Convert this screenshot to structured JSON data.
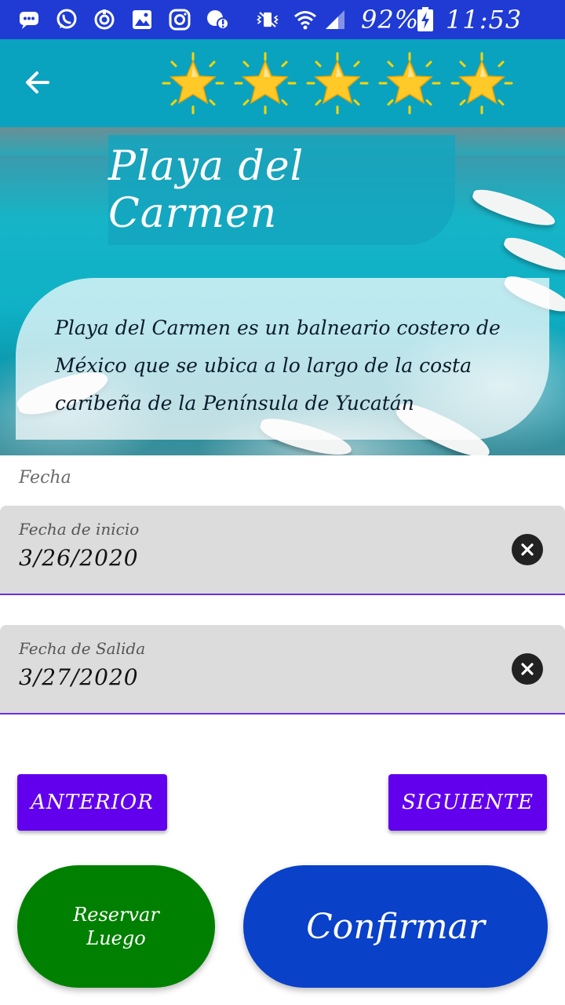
{
  "status_bar": {
    "battery": "92%",
    "time": "11:53 PM",
    "background": "#1f3bd4",
    "icons": [
      "messages-icon",
      "whatsapp-icon",
      "sync-icon",
      "gallery-icon",
      "instagram-icon",
      "chat-alert-icon",
      "vibrate-icon",
      "wifi-icon",
      "signal-icon",
      "battery-charging-icon"
    ]
  },
  "toolbar": {
    "back_icon": "arrow-left-icon",
    "rating": 5,
    "rating_max": 5,
    "background": "#0aa3bf"
  },
  "destination": {
    "title": "Playa del Carmen",
    "description": "Playa del Carmen es un balneario costero de México que se ubica a lo largo de la costa caribeña de la Península de Yucatán"
  },
  "dates": {
    "section_label": "Fecha",
    "start": {
      "label": "Fecha de inicio",
      "value": "3/26/2020"
    },
    "end": {
      "label": "Fecha de Salida",
      "value": "3/27/2020"
    },
    "clear_icon": "close-circle-icon",
    "underline_color": "#6a2ee0"
  },
  "actions": {
    "previous_label": "ANTERIOR",
    "next_label": "SIGUIENTE",
    "reserve_later_label": "Reservar Luego",
    "confirm_label": "Confirmar"
  },
  "colors": {
    "primary": "#6200ee",
    "reserve_later": "#008000",
    "confirm": "#0a41c9"
  }
}
